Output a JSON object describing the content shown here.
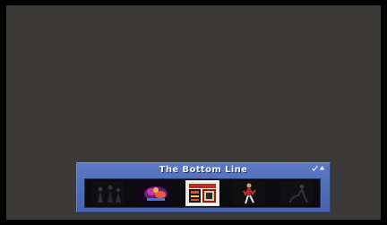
{
  "carousel": {
    "title": "The Bottom Line",
    "selected_index": 2,
    "items": [
      {
        "icon": "dark-dancers-thumbnail-icon",
        "selected": false
      },
      {
        "icon": "neon-stage-thumbnail-icon",
        "selected": false
      },
      {
        "icon": "bottom-line-poster-thumbnail-icon",
        "selected": true
      },
      {
        "icon": "dancer-figure-thumbnail-icon",
        "selected": false
      },
      {
        "icon": "shadow-figure-thumbnail-icon",
        "selected": false
      }
    ]
  },
  "colors": {
    "background": "#3b3a36",
    "frame": "#000000",
    "panel": "#5c79c4",
    "title_text": "#f2f5ff",
    "strip": "#0c0c10"
  }
}
